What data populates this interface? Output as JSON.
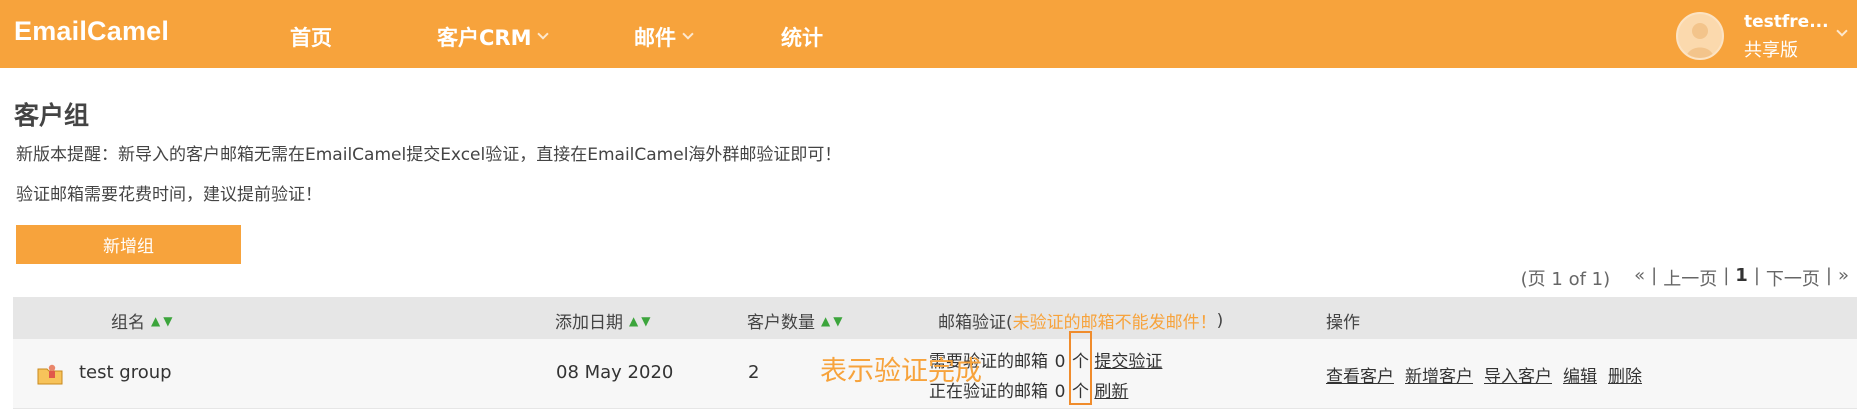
{
  "app": {
    "logo": "EmailCamel"
  },
  "nav": [
    {
      "label": "首页",
      "dropdown": false
    },
    {
      "label": "客户CRM",
      "dropdown": true
    },
    {
      "label": "邮件",
      "dropdown": true
    },
    {
      "label": "统计",
      "dropdown": false
    }
  ],
  "user": {
    "name": "testfre...",
    "plan": "共享版"
  },
  "page": {
    "title": "客户组",
    "notice1": "新版本提醒：新导入的客户邮箱无需在EmailCamel提交Excel验证，直接在EmailCamel海外群邮验证即可！",
    "notice2": "验证邮箱需要花费时间，建议提前验证！",
    "add_button": "新增组"
  },
  "pagination": {
    "info": "(页 1 of 1)",
    "first": "«",
    "prev": "上一页",
    "current": "1",
    "next": "下一页",
    "last": "»"
  },
  "table": {
    "headers": {
      "name": "组名",
      "date": "添加日期",
      "count": "客户数量",
      "verify": "邮箱验证(",
      "verify_warning": "未验证的邮箱不能发邮件！",
      "verify_close": ")",
      "ops": "操作"
    },
    "rows": [
      {
        "name": "test group",
        "date": "08 May 2020",
        "count": "2",
        "need_label": "需要验证的邮箱",
        "need_count": "0",
        "need_unit": "个",
        "need_action": "提交验证",
        "doing_label": "正在验证的邮箱",
        "doing_count": "0",
        "doing_unit": "个",
        "doing_action": "刷新",
        "ops": [
          "查看客户",
          "新增客户",
          "导入客户",
          "编辑",
          "删除"
        ]
      }
    ]
  },
  "annotation": "表示验证完成",
  "colors": {
    "brand": "#f7a33c",
    "header_bg": "#e6e6e6",
    "sort_arrow": "#3ca53c"
  },
  "icons": {
    "sort": "sort-arrows-icon",
    "group": "group-folder-icon",
    "avatar": "user-avatar-icon"
  }
}
